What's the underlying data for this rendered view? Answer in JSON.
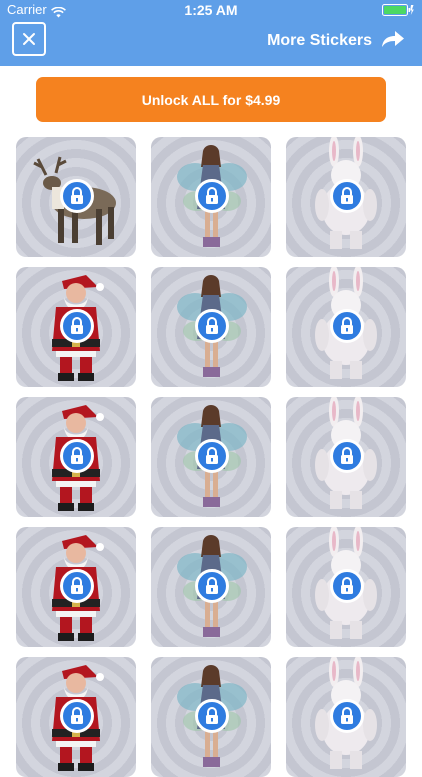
{
  "status_bar": {
    "carrier": "Carrier",
    "time": "1:25 AM"
  },
  "header": {
    "close_icon": "close-icon",
    "more_stickers_label": "More Stickers",
    "arrow_icon": "share-arrow-icon",
    "color": "#5f9fe8"
  },
  "unlock": {
    "label": "Unlock ALL for $4.99",
    "color": "#f5821f"
  },
  "stickers": [
    {
      "subject": "reindeer",
      "locked": true
    },
    {
      "subject": "fairy",
      "locked": true
    },
    {
      "subject": "easter bunny",
      "locked": true
    },
    {
      "subject": "santa claus",
      "locked": true
    },
    {
      "subject": "fairy",
      "locked": true
    },
    {
      "subject": "easter bunny",
      "locked": true
    },
    {
      "subject": "santa claus",
      "locked": true
    },
    {
      "subject": "fairy",
      "locked": true
    },
    {
      "subject": "easter bunny",
      "locked": true
    },
    {
      "subject": "santa claus",
      "locked": true
    },
    {
      "subject": "fairy",
      "locked": true
    },
    {
      "subject": "easter bunny",
      "locked": true
    },
    {
      "subject": "santa claus",
      "locked": true
    },
    {
      "subject": "fairy",
      "locked": true
    },
    {
      "subject": "easter bunny",
      "locked": true
    }
  ]
}
